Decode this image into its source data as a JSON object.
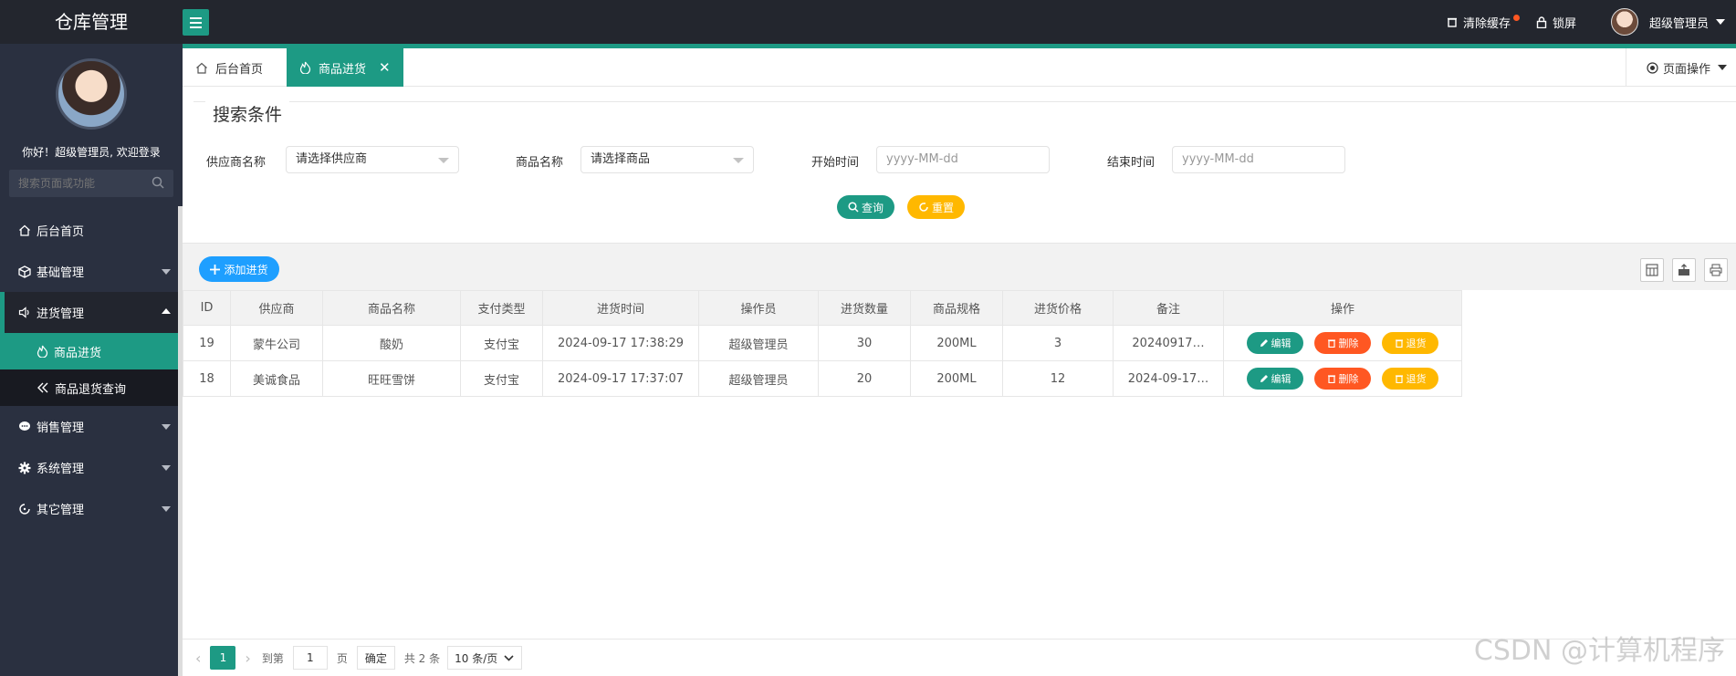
{
  "app": {
    "title": "仓库管理"
  },
  "header": {
    "clear_cache": "清除缓存",
    "lock_screen": "锁屏",
    "user_name": "超级管理员"
  },
  "sidebar": {
    "welcome": "你好！超级管理员, 欢迎登录",
    "search_placeholder": "搜索页面或功能",
    "items": [
      {
        "label": "后台首页"
      },
      {
        "label": "基础管理"
      },
      {
        "label": "进货管理"
      },
      {
        "label": "销售管理"
      },
      {
        "label": "系统管理"
      },
      {
        "label": "其它管理"
      }
    ],
    "sub_items": [
      {
        "label": "商品进货"
      },
      {
        "label": "商品退货查询"
      }
    ]
  },
  "tabs": [
    {
      "label": "后台首页"
    },
    {
      "label": "商品进货"
    }
  ],
  "page_ops": "页面操作",
  "search": {
    "legend": "搜索条件",
    "supplier_label": "供应商名称",
    "supplier_value": "请选择供应商",
    "goods_label": "商品名称",
    "goods_value": "请选择商品",
    "start_label": "开始时间",
    "start_placeholder": "yyyy-MM-dd",
    "end_label": "结束时间",
    "end_placeholder": "yyyy-MM-dd",
    "query_btn": "查询",
    "reset_btn": "重置"
  },
  "toolbar": {
    "add_btn": "添加进货"
  },
  "table": {
    "columns": [
      "ID",
      "供应商",
      "商品名称",
      "支付类型",
      "进货时间",
      "操作员",
      "进货数量",
      "商品规格",
      "进货价格",
      "备注",
      "操作"
    ],
    "rows": [
      [
        "19",
        "蒙牛公司",
        "酸奶",
        "支付宝",
        "2024-09-17 17:38:29",
        "超级管理员",
        "30",
        "200ML",
        "3",
        "20240917…"
      ],
      [
        "18",
        "美诚食品",
        "旺旺雪饼",
        "支付宝",
        "2024-09-17 17:37:07",
        "超级管理员",
        "20",
        "200ML",
        "12",
        "2024-09-17…"
      ]
    ],
    "actions": {
      "edit": "编辑",
      "delete": "删除",
      "return": "退货"
    }
  },
  "pager": {
    "current": "1",
    "goto_label": "到第",
    "goto_value": "1",
    "page_unit": "页",
    "confirm": "确定",
    "total": "共 2 条",
    "page_size": "10 条/页"
  },
  "watermark": "CSDN @计算机程序",
  "colors": {
    "accent": "#1d9a84",
    "blue": "#1e9fff",
    "red": "#ff5722",
    "orange": "#ffb800",
    "dark": "#23262e"
  }
}
